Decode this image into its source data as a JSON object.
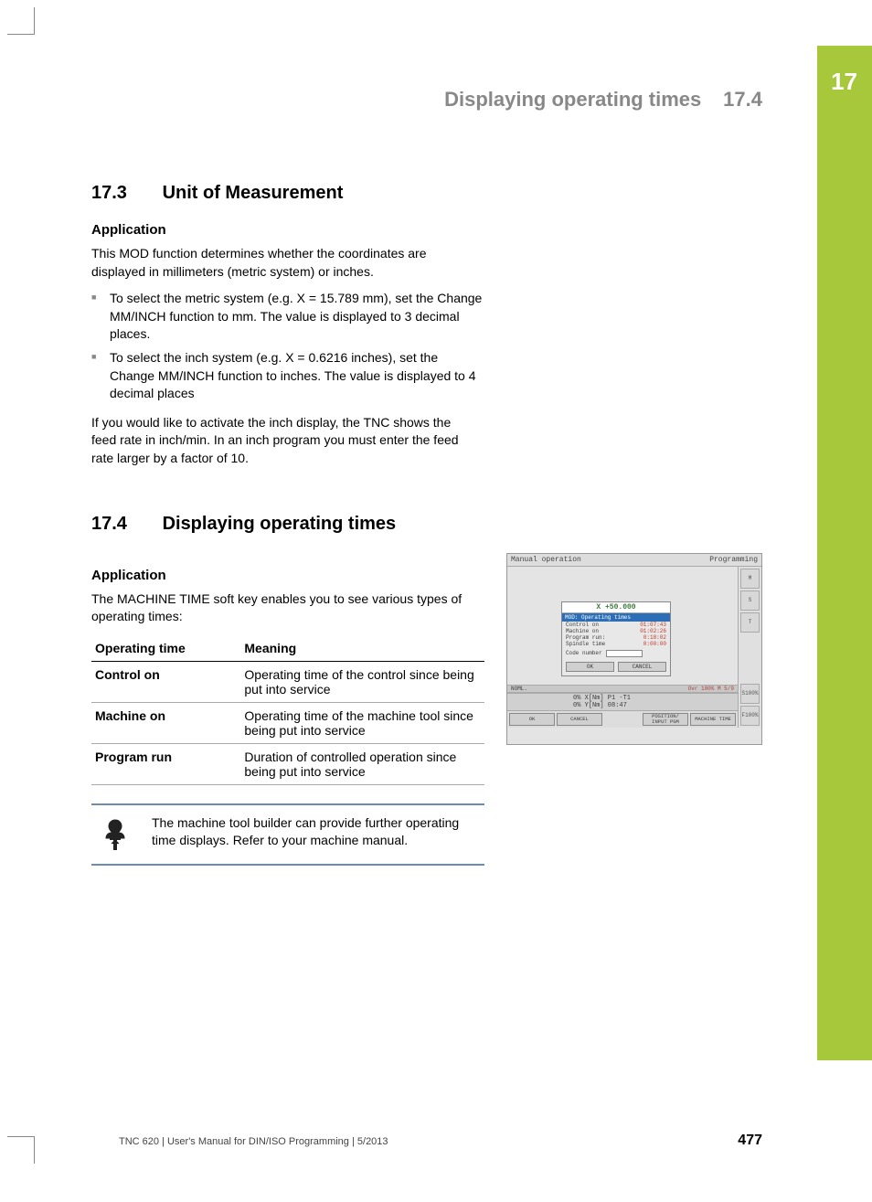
{
  "chapter_number": "17",
  "header": {
    "title": "Displaying operating times",
    "section_number": "17.4"
  },
  "section_17_3": {
    "number": "17.3",
    "title": "Unit of Measurement",
    "application_heading": "Application",
    "intro": "This MOD function determines whether the coordinates are displayed in millimeters (metric system) or inches.",
    "bullets": [
      "To select the metric system (e.g. X = 15.789 mm), set the Change MM/INCH function to mm. The value is displayed to 3 decimal places.",
      "To select the inch system (e.g. X = 0.6216 inches), set the Change MM/INCH function to inches. The value is displayed to 4 decimal places"
    ],
    "outro": "If you would like to activate the inch display, the TNC shows the feed rate in inch/min. In an inch program you must enter the feed rate larger by a factor of 10."
  },
  "section_17_4": {
    "number": "17.4",
    "title": "Displaying operating times",
    "application_heading": "Application",
    "intro": "The MACHINE TIME soft key enables you to see various types of operating times:",
    "table": {
      "headers": [
        "Operating time",
        "Meaning"
      ],
      "rows": [
        {
          "name": "Control on",
          "meaning": "Operating time of the control since being put into service"
        },
        {
          "name": "Machine on",
          "meaning": "Operating time of the machine tool since being put into service"
        },
        {
          "name": "Program run",
          "meaning": "Duration of controlled operation since being put into service"
        }
      ]
    },
    "note": "The machine tool builder can provide further operating time displays. Refer to your machine manual."
  },
  "screenshot": {
    "title_left": "Manual operation",
    "title_right": "Programming",
    "coord": "X   +50.000",
    "dialog_title": "MOD: Operating times",
    "rows": [
      {
        "label": "Control on",
        "value": "01:07:43"
      },
      {
        "label": "Machine on",
        "value": "01:02:26"
      },
      {
        "label": "Program run:",
        "value": "0:18:02"
      },
      {
        "label": "Spindle time",
        "value": "0:00:00"
      }
    ],
    "code_label": "Code number",
    "btn_ok": "OK",
    "btn_cancel": "CANCEL",
    "statusbar_top_left": "NOML.",
    "statusbar_top_ovr": "Ovr 100%  M 5/9",
    "status_line1": "0% X[Nm]  P1   -T1",
    "status_line2": "0% Y[Nm]  08:47",
    "bottom": [
      "OK",
      "CANCEL",
      "POSITION/\nINPUT PGM",
      "MACHINE\nTIME"
    ],
    "side_labels": [
      "M",
      "S",
      "T",
      "S100%",
      "F100%"
    ]
  },
  "footer": {
    "left": "TNC 620 | User's Manual for DIN/ISO Programming | 5/2013",
    "page": "477"
  }
}
